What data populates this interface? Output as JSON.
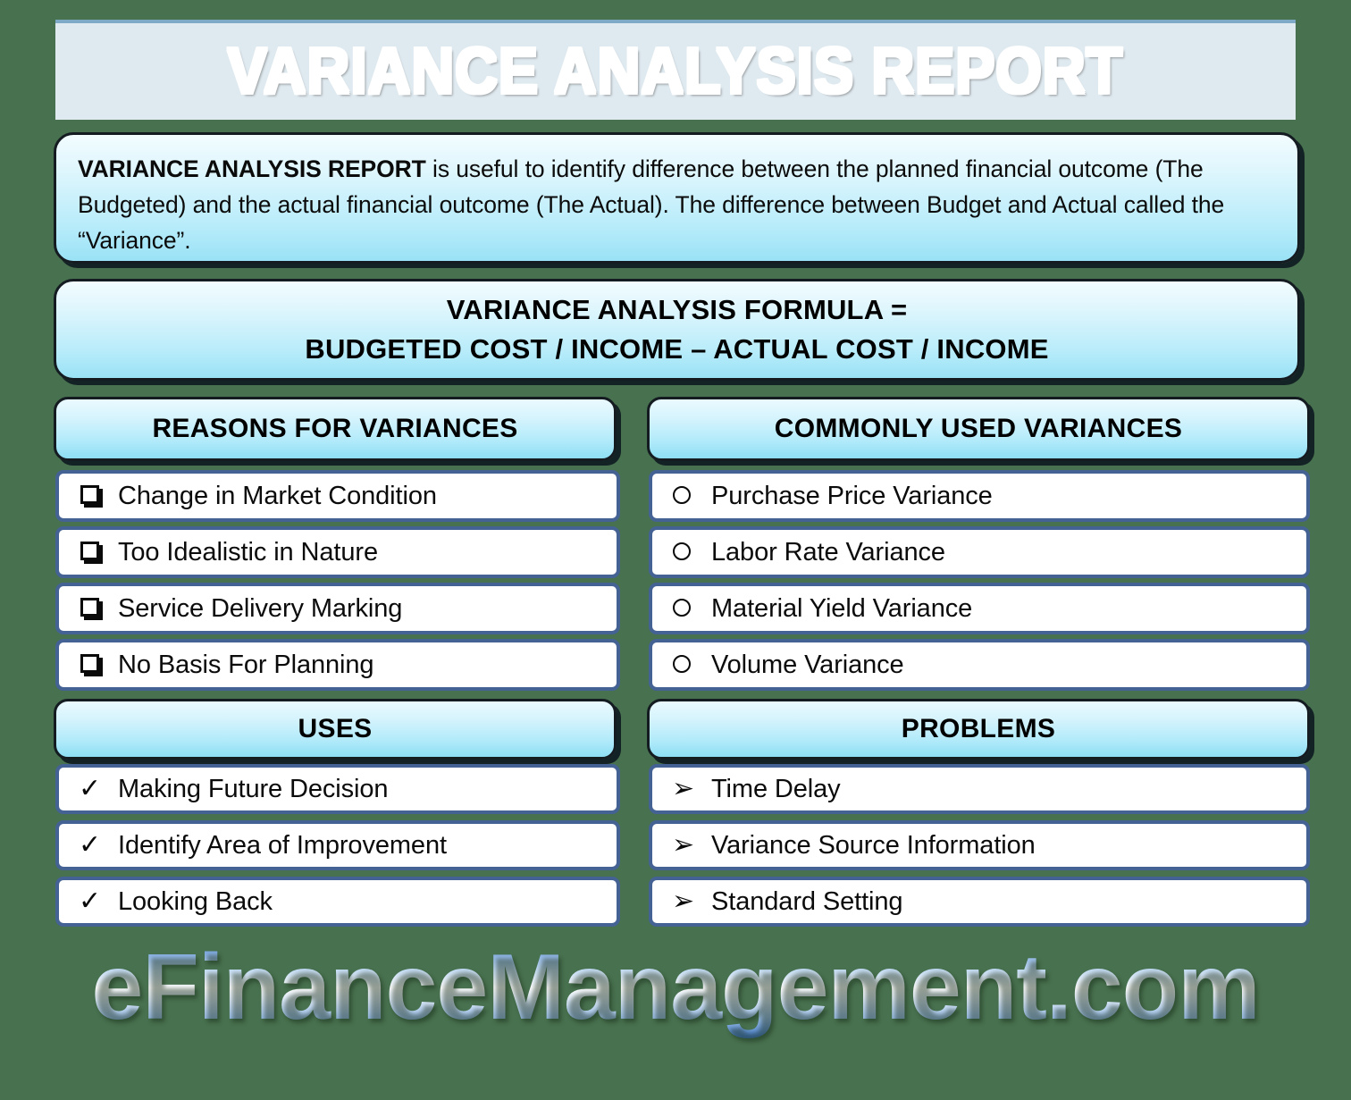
{
  "background_color": "#48714f",
  "banner": {
    "title": "VARIANCE ANALYSIS REPORT",
    "bg_color": "#dfeaf0",
    "accent_color": "#7ea9c7"
  },
  "description": {
    "bold_lead": "VARIANCE ANALYSIS REPORT",
    "body": " is useful to identify difference between the planned financial outcome (The Budgeted) and the actual financial outcome (The Actual). The difference between Budget and Actual called the “Variance”."
  },
  "formula": {
    "line1": "VARIANCE ANALYSIS FORMULA =",
    "line2": "BUDGETED COST / INCOME – ACTUAL COST / INCOME"
  },
  "sections": {
    "reasons": {
      "header": "REASONS FOR VARIANCES",
      "bullet_style": "square",
      "items": [
        "Change in Market Condition",
        "Too Idealistic in Nature",
        "Service Delivery Marking",
        "No Basis For Planning"
      ]
    },
    "commonly_used": {
      "header": "COMMONLY USED VARIANCES",
      "bullet_style": "circle",
      "items": [
        "Purchase Price Variance",
        "Labor Rate Variance",
        "Material Yield Variance",
        "Volume Variance"
      ]
    },
    "uses": {
      "header": "USES",
      "bullet_style": "check",
      "items": [
        "Making Future Decision",
        "Identify Area of Improvement",
        "Looking Back"
      ]
    },
    "problems": {
      "header": "PROBLEMS",
      "bullet_style": "arrow",
      "items": [
        "Time Delay",
        "Variance Source Information",
        "Standard Setting"
      ]
    }
  },
  "bullets": {
    "check_glyph": "✓",
    "arrow_glyph": "➢"
  },
  "footer": {
    "brand": "eFinanceManagement.com",
    "accent_color": "#5b8fd6"
  }
}
